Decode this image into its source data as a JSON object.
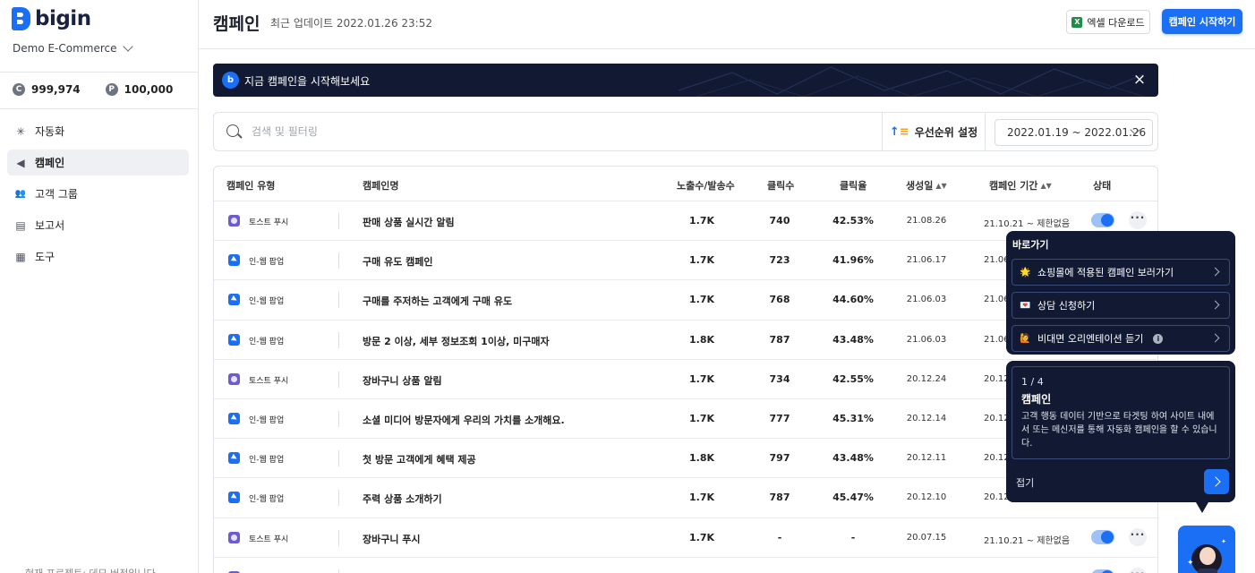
{
  "sidebar": {
    "brand": "bigin",
    "org": "Demo E-Commerce",
    "credits": [
      {
        "icon": "C",
        "value": "999,974"
      },
      {
        "icon": "P",
        "value": "100,000"
      }
    ],
    "nav": [
      {
        "label": "자동화",
        "icon": "automation-icon",
        "glyph": "✳"
      },
      {
        "label": "캠페인",
        "icon": "megaphone-icon",
        "glyph": "◀"
      },
      {
        "label": "고객 그룹",
        "icon": "users-icon",
        "glyph": "👥"
      },
      {
        "label": "보고서",
        "icon": "report-icon",
        "glyph": "▤"
      },
      {
        "label": "도구",
        "icon": "tools-icon",
        "glyph": "▦"
      }
    ],
    "footer": "현재 프로젝트: 데모 버전입니다"
  },
  "header": {
    "title": "캠페인",
    "last_update": "최근 업데이트 2022.01.26 23:52",
    "excel_label": "엑셀 다운로드",
    "start_label": "캠페인 시작하기"
  },
  "banner": {
    "text": "지금 캠페인을 시작해보세요",
    "close": "×"
  },
  "search": {
    "placeholder": "검색 및 필터링",
    "priority_label": "우선순위 설정",
    "date_range": "2022.01.19 ~ 2022.01.26"
  },
  "table": {
    "headers": {
      "type": "캠페인 유형",
      "name": "캠페인명",
      "impressions": "노출수/발송수",
      "clicks": "클릭수",
      "rate": "클릭율",
      "created": "생성일",
      "period": "캠페인 기간",
      "status": "상태"
    },
    "rows": [
      {
        "kind": "push",
        "type": "토스트 푸시",
        "name": "판매 상품 실시간 알림",
        "impressions": "1.7K",
        "clicks": "740",
        "rate": "42.53%",
        "created": "21.08.26",
        "period": "21.10.21 ~ 제한없음",
        "on": true
      },
      {
        "kind": "popup",
        "type": "인-웹 팝업",
        "name": "구매 유도 캠페인",
        "impressions": "1.7K",
        "clicks": "723",
        "rate": "41.96%",
        "created": "21.06.17",
        "period": "21.06.",
        "on": false
      },
      {
        "kind": "popup",
        "type": "인-웹 팝업",
        "name": "구매를 주저하는 고객에게 구매 유도",
        "impressions": "1.7K",
        "clicks": "768",
        "rate": "44.60%",
        "created": "21.06.03",
        "period": "21.06.",
        "on": false
      },
      {
        "kind": "popup",
        "type": "인-웹 팝업",
        "name": "방문 2 이상, 세부 정보조회 1이상, 미구매자",
        "impressions": "1.8K",
        "clicks": "787",
        "rate": "43.48%",
        "created": "21.06.03",
        "period": "21.06.",
        "on": false
      },
      {
        "kind": "push",
        "type": "토스트 푸시",
        "name": "장바구니 상품 알림",
        "impressions": "1.7K",
        "clicks": "734",
        "rate": "42.55%",
        "created": "20.12.24",
        "period": "20.12.",
        "on": false
      },
      {
        "kind": "popup",
        "type": "인-웹 팝업",
        "name": "소셜 미디어 방문자에게 우리의 가치를 소개해요.",
        "impressions": "1.7K",
        "clicks": "777",
        "rate": "45.31%",
        "created": "20.12.14",
        "period": "20.12.",
        "on": false
      },
      {
        "kind": "popup",
        "type": "인-웹 팝업",
        "name": "첫 방문 고객에게 혜택 제공",
        "impressions": "1.8K",
        "clicks": "797",
        "rate": "43.48%",
        "created": "20.12.11",
        "period": "20.12.",
        "on": false
      },
      {
        "kind": "popup",
        "type": "인-웹 팝업",
        "name": "주력 상품 소개하기",
        "impressions": "1.7K",
        "clicks": "787",
        "rate": "45.47%",
        "created": "20.12.10",
        "period": "20.12.",
        "on": false
      },
      {
        "kind": "push",
        "type": "토스트 푸시",
        "name": "장바구니 푸시",
        "impressions": "1.7K",
        "clicks": "-",
        "rate": "-",
        "created": "20.07.15",
        "period": "21.10.21 ~ 제한없음",
        "on": true
      },
      {
        "kind": "push",
        "type": "토스트 푸시",
        "name": "",
        "impressions": "",
        "clicks": "",
        "rate": "",
        "created": "",
        "period": "",
        "on": true
      }
    ]
  },
  "shortcut": {
    "title": "바로가기",
    "items": [
      {
        "emoji": "🌟",
        "label": "쇼핑몰에 적용된 캠페인 보러가기",
        "info": false
      },
      {
        "emoji": "💌",
        "label": "상담 신청하기",
        "info": false
      },
      {
        "emoji": "🙋",
        "label": "비대면 오리엔테이션 듣기",
        "info": true
      }
    ]
  },
  "tour": {
    "step": "1 / 4",
    "title": "캠페인",
    "description": "고객 행동 데이터 기반으로 타겟팅 하여 사이트 내에서 또는 메신저를 통해 자동화 캠페인을 할 수 있습니다.",
    "collapse": "접기"
  },
  "colors": {
    "accent": "#1a6ff4",
    "navy": "#121a33",
    "push": "#6d5bd0"
  }
}
